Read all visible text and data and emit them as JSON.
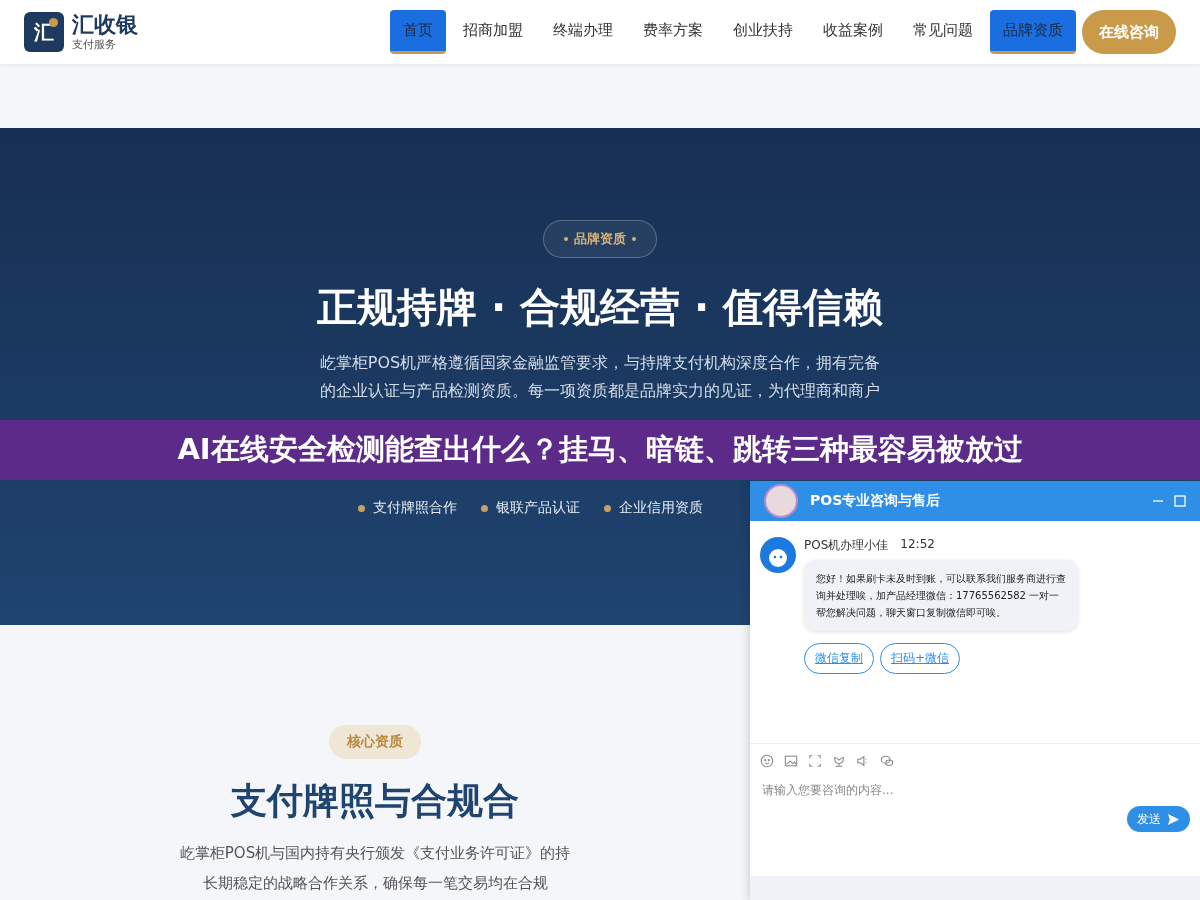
{
  "header": {
    "logo_mark": "汇",
    "brand": "汇收银",
    "tagline": "支付服务",
    "nav": [
      {
        "label": "首页",
        "selected": true
      },
      {
        "label": "招商加盟",
        "selected": false
      },
      {
        "label": "终端办理",
        "selected": false
      },
      {
        "label": "费率方案",
        "selected": false
      },
      {
        "label": "创业扶持",
        "selected": false
      },
      {
        "label": "收益案例",
        "selected": false
      },
      {
        "label": "常见问题",
        "selected": false
      },
      {
        "label": "品牌资质",
        "selected": true
      }
    ],
    "cta": "在线咨询"
  },
  "hero": {
    "badge": "品牌资质",
    "title": "正规持牌 · 合规经营 · 值得信赖",
    "paragraph_lines": [
      "屹掌柜POS机严格遵循国家金融监管要求，与持牌支付机构深度合作，拥有完备",
      "的企业认证与产品检测资质。每一项资质都是品牌实力的见证，为代理商和商户"
    ],
    "points": [
      "支付牌照合作",
      "银联产品认证",
      "企业信用资质"
    ]
  },
  "article_banner": "AI在线安全检测能查出什么？挂马、暗链、跳转三种最容易被放过",
  "section": {
    "badge": "核心资质",
    "title": "支付牌照与合规合",
    "paragraph_lines": [
      "屹掌柜POS机与国内持有央行颁发《支付业务许可证》的持",
      "长期稳定的战略合作关系，确保每一笔交易均在合规"
    ]
  },
  "chat": {
    "title": "POS专业咨询与售后",
    "sender": "POS机办理小佳",
    "time": "12:52",
    "message": "您好！如果刷卡未及时到账，可以联系我们服务商进行查询并处理唉，加产品经理微信：17765562582 一对一帮您解决问题，聊天窗口复制微信即可唉。",
    "quick_links": [
      "微信复制",
      "扫码+微信"
    ],
    "input": {
      "placeholder": "请输入您要咨询的内容..."
    },
    "send": "发送"
  }
}
